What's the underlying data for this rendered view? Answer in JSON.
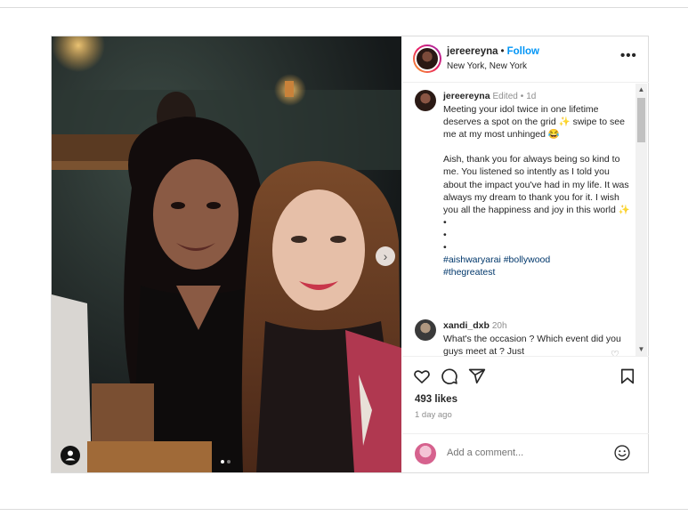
{
  "post": {
    "username": "jereereyna",
    "follow_label": "Follow",
    "bullet": "•",
    "location": "New York, New York",
    "more_icon": "•••",
    "caption": {
      "username": "jereereyna",
      "edited": "Edited",
      "bullet": "•",
      "age": "1d",
      "line1": "Meeting your idol twice in one lifetime deserves a spot on the grid ✨ swipe to see me at my most unhinged 😂",
      "line2": "Aish, thank you for always being so kind to me. You listened so intently as I told you about the impact you've had in my life. It was always my dream to thank you for it. I wish you all the happiness and joy in this world ✨",
      "dot_lines": [
        "•",
        "•",
        "•"
      ],
      "hashtags_line1": "#aishwaryarai #bollywood",
      "hashtags_line2": "#thegreatest"
    },
    "comment": {
      "username": "xandi_dxb",
      "age": "20h",
      "text": "What's the occasion ? Which event did you guys meet at ? Just"
    },
    "likes": "493 likes",
    "time_ago": "1 day ago",
    "add_comment_placeholder": "Add a comment...",
    "next_arrow": "›",
    "scroll_up": "▲",
    "scroll_down": "▼",
    "heart_small": "♡"
  },
  "icons": {
    "like": "heart-icon",
    "comment": "comment-icon",
    "share": "paper-plane-icon",
    "save": "bookmark-icon",
    "emoji": "smiley-icon",
    "user_tag": "user-tag-icon"
  },
  "colors": {
    "link_blue": "#0095f6",
    "hashtag": "#00376b",
    "muted": "#8e8e8e",
    "border": "#dbdbdb"
  }
}
